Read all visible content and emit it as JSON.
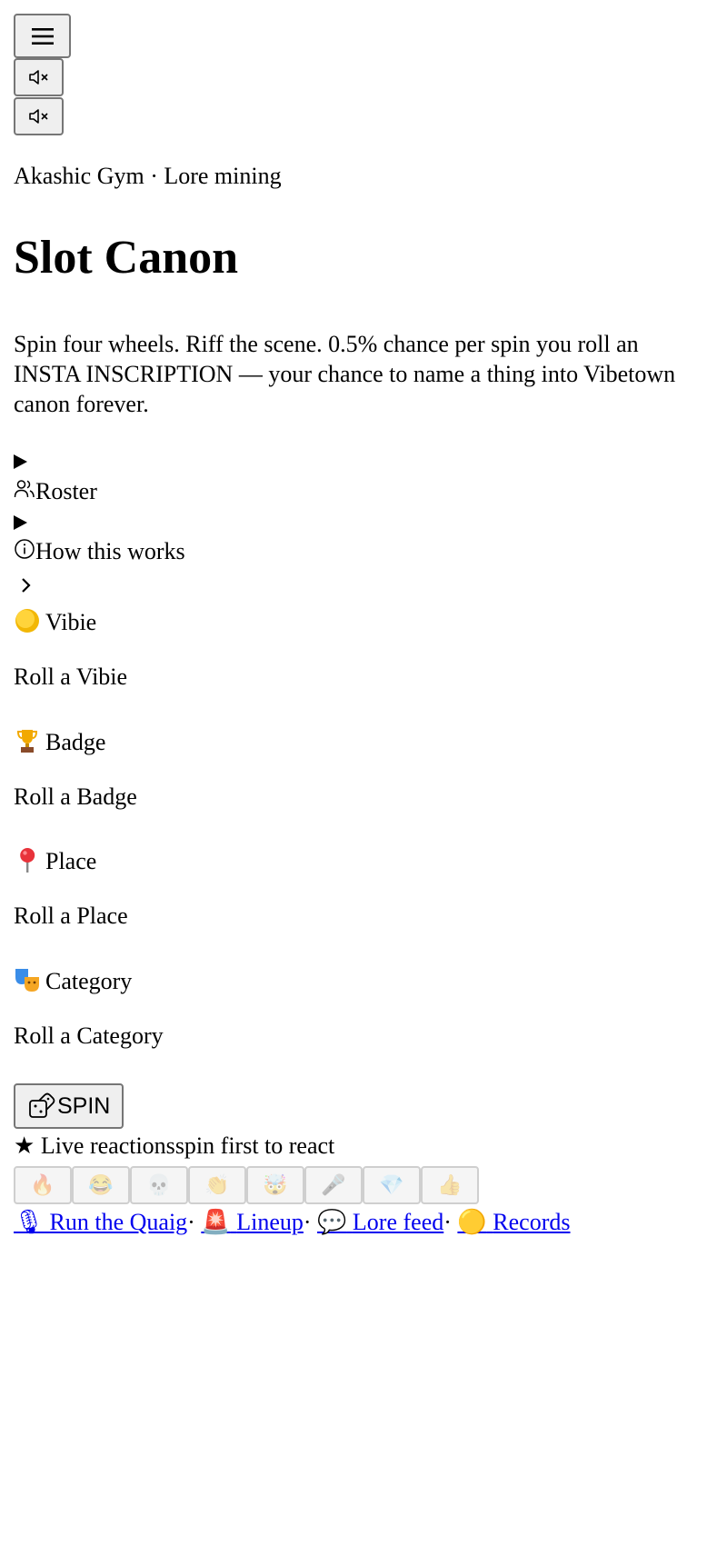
{
  "header": {
    "menu_button": "menu-icon",
    "mute_buttons": [
      "mute-icon",
      "mute-icon"
    ],
    "eyebrow": "Akashic Gym · Lore mining",
    "title": "Slot Canon",
    "description": "Spin four wheels. Riff the scene. 0.5% chance per spin you roll an INSTA INSCRIPTION — your chance to name a thing into Vibetown canon forever."
  },
  "details": {
    "roster_label": "Roster",
    "how_label": "How this works"
  },
  "wheels": [
    {
      "emoji": "🟡",
      "label": "Vibie",
      "value": "Roll a Vibie"
    },
    {
      "emoji": "🏆",
      "label": "Badge",
      "value": "Roll a Badge"
    },
    {
      "emoji": "📍",
      "label": "Place",
      "value": "Roll a Place"
    },
    {
      "emoji": "🎭",
      "label": "Category",
      "value": "Roll a Category"
    }
  ],
  "spin": {
    "label": "SPIN",
    "icon": "dice-icon"
  },
  "reactions": {
    "star": "★",
    "title": "Live reactions",
    "hint": "spin first to react",
    "emojis": [
      "🔥",
      "😂",
      "💀",
      "👏",
      "🤯",
      "🎤",
      "💎",
      "👍"
    ]
  },
  "nav": {
    "links": [
      {
        "emoji": "🎙",
        "label": "Run the Quaig"
      },
      {
        "emoji": "🚨",
        "label": "Lineup"
      },
      {
        "emoji": "💬",
        "label": "Lore feed"
      },
      {
        "emoji": "🟡",
        "label": "Records"
      }
    ],
    "separator": "·"
  },
  "colors": {
    "link": "#0000ee",
    "button_bg": "#efefef",
    "button_border": "#767676"
  }
}
